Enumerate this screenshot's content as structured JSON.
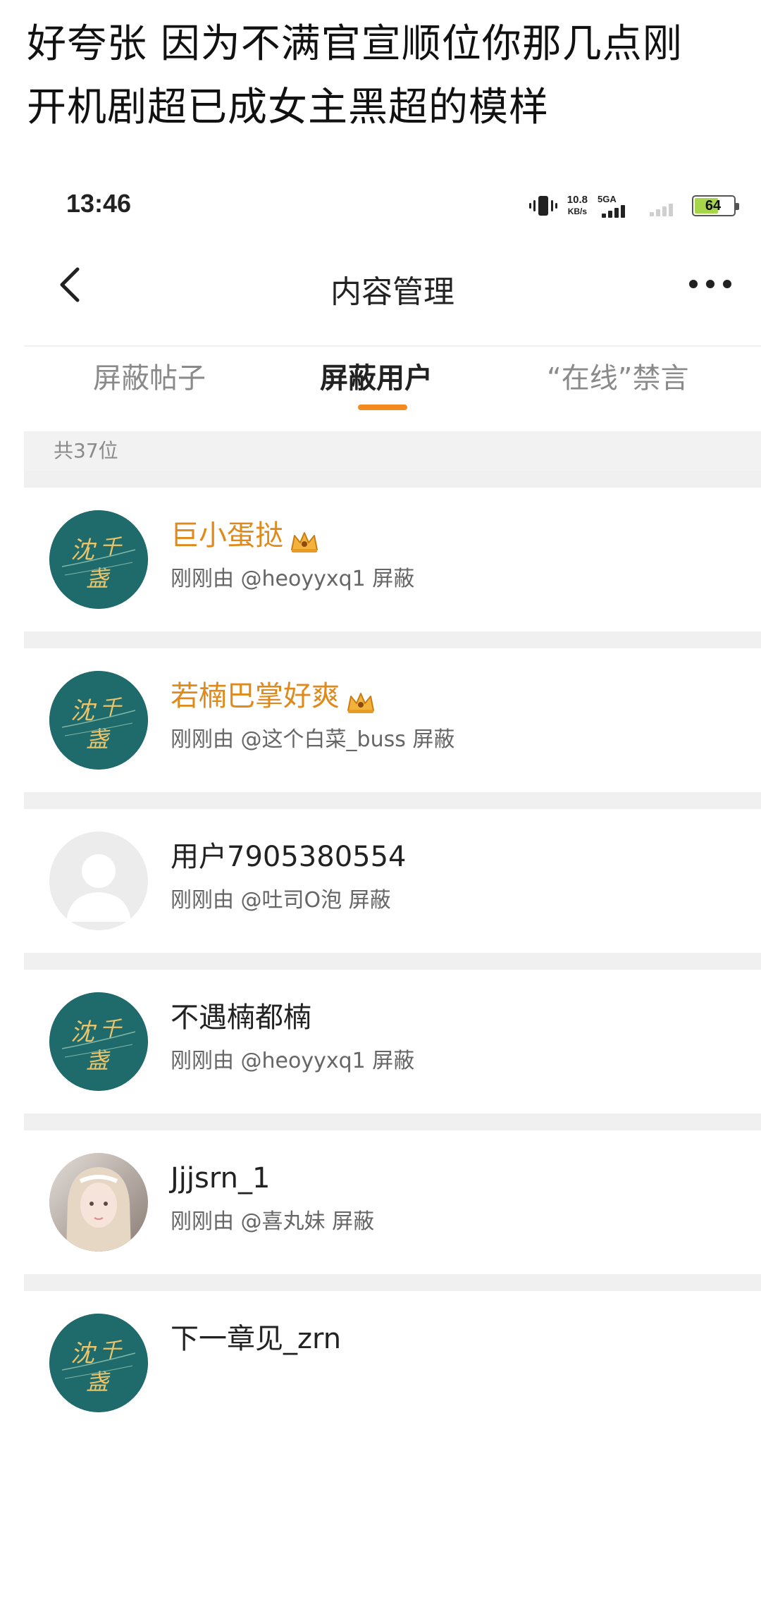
{
  "caption": {
    "line1": "好夸张 因为不满官宣顺位你那几点刚",
    "line2": "开机剧超已成女主黑超的模样"
  },
  "status_bar": {
    "time": "13:46",
    "net_speed_value": "10.8",
    "net_speed_unit": "KB/s",
    "network": "5GA",
    "battery": "64",
    "battery_fill_fraction": 0.64
  },
  "nav": {
    "title": "内容管理",
    "back_icon": "chevron-left-icon",
    "more_icon": "more-dots-icon"
  },
  "tabs": [
    {
      "label": "屏蔽帖子",
      "active": false
    },
    {
      "label": "屏蔽用户",
      "active": true
    },
    {
      "label": "“在线”禁言",
      "active": false
    }
  ],
  "accent_color": "#f28a1e",
  "vip_name_color": "#e08a1c",
  "count_label": "共37位",
  "users": [
    {
      "name": "巨小蛋挞",
      "vip": true,
      "avatar": "teal-logo",
      "blocked_by": "刚刚由 @heoyyxq1 屏蔽"
    },
    {
      "name": "若楠巴掌好爽",
      "vip": true,
      "avatar": "teal-logo",
      "blocked_by": "刚刚由 @这个白菜_buss 屏蔽"
    },
    {
      "name": "用户7905380554",
      "vip": false,
      "avatar": "default",
      "blocked_by": "刚刚由 @吐司O泡 屏蔽"
    },
    {
      "name": "不遇楠都楠",
      "vip": false,
      "avatar": "teal-logo",
      "blocked_by": "刚刚由 @heoyyxq1 屏蔽"
    },
    {
      "name": "Jjjsrn_1",
      "vip": false,
      "avatar": "photo",
      "blocked_by": "刚刚由 @喜丸妹 屏蔽"
    },
    {
      "name": "下一章见_zrn",
      "vip": false,
      "avatar": "teal-logo",
      "blocked_by": ""
    }
  ]
}
